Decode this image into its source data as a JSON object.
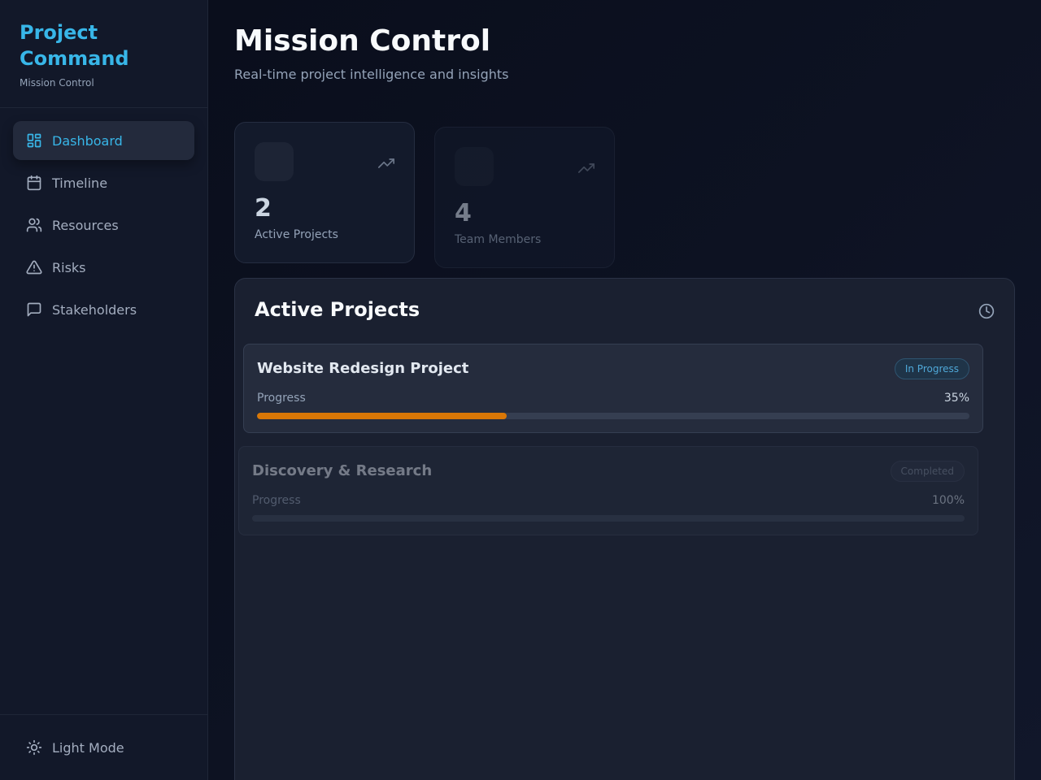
{
  "sidebar": {
    "brand": {
      "title": "Project Command",
      "subtitle": "Mission Control"
    },
    "items": [
      {
        "label": "Dashboard",
        "icon": "dashboard-icon",
        "active": true
      },
      {
        "label": "Timeline",
        "icon": "calendar-icon",
        "active": false
      },
      {
        "label": "Resources",
        "icon": "users-icon",
        "active": false
      },
      {
        "label": "Risks",
        "icon": "warning-icon",
        "active": false
      },
      {
        "label": "Stakeholders",
        "icon": "message-icon",
        "active": false
      }
    ],
    "footer": {
      "label": "Light Mode",
      "icon": "sun-icon"
    }
  },
  "header": {
    "title": "Mission Control",
    "subtitle": "Real-time project intelligence and insights"
  },
  "stats": [
    {
      "value": "2",
      "label": "Active Projects",
      "icon": "trend-up-icon"
    },
    {
      "value": "4",
      "label": "Team Members",
      "icon": "trend-up-icon"
    }
  ],
  "active_projects": {
    "title": "Active Projects",
    "icon": "clock-icon",
    "progress_label": "Progress",
    "projects": [
      {
        "name": "Website Redesign Project",
        "status": "In Progress",
        "progress_text": "35%",
        "progress": 0.35,
        "fill_color": "#d97706"
      },
      {
        "name": "Discovery & Research",
        "status": "Completed",
        "progress_text": "100%",
        "progress": 1.0,
        "fill_color": "#3b4456"
      }
    ]
  },
  "colors": {
    "accent": "#38b6e8",
    "background": "#0b0f1e",
    "progress_orange": "#d97706"
  }
}
